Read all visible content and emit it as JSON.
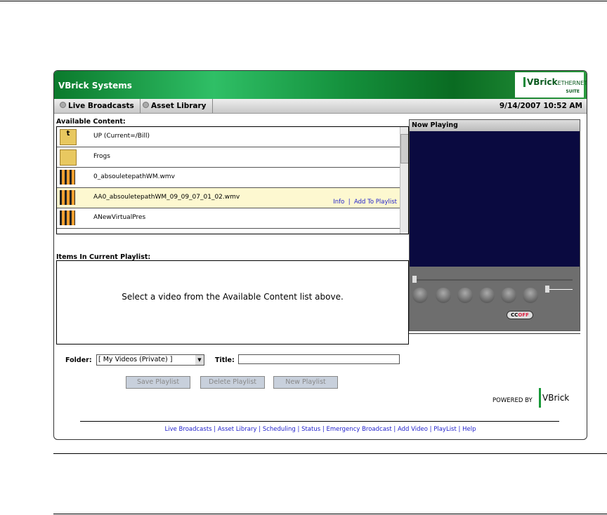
{
  "header": {
    "title": "VBrick Systems",
    "logo": "VBrick EtherneTV Suite"
  },
  "nav": {
    "items": [
      "Live Broadcasts",
      "Asset Library"
    ],
    "datetime": "9/14/2007 10:52 AM"
  },
  "available": {
    "label": "Available Content:",
    "items": [
      {
        "name": "UP (Current=/Bill)",
        "icon": "folder-up-icon"
      },
      {
        "name": "Frogs",
        "icon": "folder-icon"
      },
      {
        "name": "0_absouletepathWM.wmv",
        "icon": "film-icon"
      },
      {
        "name": "AA0_absouletepathWM_09_09_07_01_02.wmv",
        "icon": "film-icon",
        "selected": true
      },
      {
        "name": "ANewVirtualPres",
        "icon": "film-icon"
      }
    ],
    "info": "Info",
    "add": "Add To Playlist"
  },
  "now_playing": {
    "title": "Now Playing",
    "cc": "CC",
    "cc_state": "OFF"
  },
  "playlist": {
    "label": "Items In Current Playlist:",
    "empty": "Select a video from the Available Content list above."
  },
  "form": {
    "folder_label": "Folder:",
    "folder_value": "[ My Videos (Private) ]",
    "title_label": "Title:",
    "title_value": "",
    "save": "Save Playlist",
    "delete": "Delete Playlist",
    "new": "New Playlist"
  },
  "powered": "POWERED BY",
  "powered_logo": "VBrick",
  "footer": [
    "Live Broadcasts",
    "Asset Library",
    "Scheduling",
    "Status",
    "Emergency Broadcast",
    "Add Video",
    "PlayList",
    "Help"
  ]
}
